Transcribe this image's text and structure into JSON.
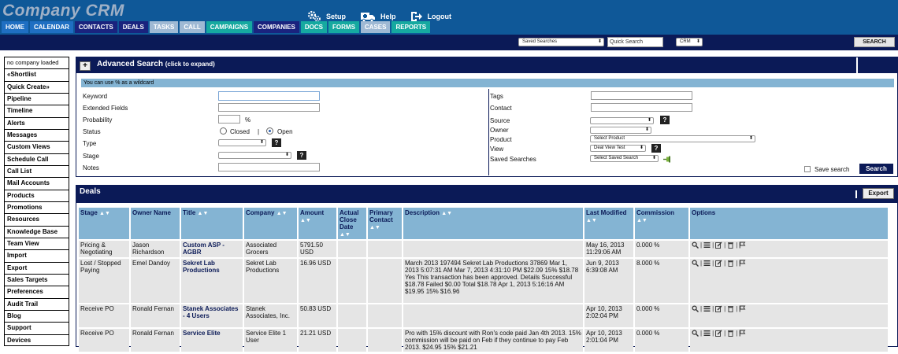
{
  "app": {
    "logo": "Company CRM",
    "top_links": [
      {
        "icon": "gears-icon",
        "label": "Setup"
      },
      {
        "icon": "ambulance-icon",
        "label": "Help"
      },
      {
        "icon": "logout-icon",
        "label": "Logout"
      }
    ],
    "nav_tabs": [
      {
        "label": "HOME",
        "style": "blue"
      },
      {
        "label": "CALENDAR",
        "style": "blue"
      },
      {
        "label": "CONTACTS",
        "style": "dark"
      },
      {
        "label": "DEALS",
        "style": "dark"
      },
      {
        "label": "TASKS",
        "style": "light"
      },
      {
        "label": "CALL",
        "style": "light"
      },
      {
        "label": "CAMPAIGNS",
        "style": "teal"
      },
      {
        "label": "COMPANIES",
        "style": "dark"
      },
      {
        "label": "DOCS",
        "style": "teal"
      },
      {
        "label": "FORMS",
        "style": "teal"
      },
      {
        "label": "CASES",
        "style": "light"
      },
      {
        "label": "REPORTS",
        "style": "teal"
      }
    ]
  },
  "search_bar": {
    "saved_searches": "Saved Searches",
    "quick_search": "Quick Search",
    "scope": "CRM",
    "search_button": "SEARCH"
  },
  "sidebar": {
    "items": [
      "no company loaded",
      "«Shortlist",
      "Quick Create»",
      "Pipeline",
      "Timeline",
      "Alerts",
      "Messages",
      "Custom Views",
      "Schedule Call",
      "Call List",
      "Mail Accounts",
      "Products",
      "Promotions",
      "Resources",
      "Knowledge Base",
      "Team View",
      "Import",
      "Export",
      "Sales Targets",
      "Preferences",
      "Audit Trail",
      "Blog",
      "Support",
      "Devices"
    ]
  },
  "advanced_search": {
    "plus": "+",
    "title": "Advanced Search",
    "subtitle": "(click to expand)",
    "wildcard_note": "You can use % as a wildcard",
    "left_fields": {
      "keyword": "Keyword",
      "extended": "Extended Fields",
      "probability": "Probability",
      "percent": "%",
      "status": "Status",
      "closed": "Closed",
      "divider": "|",
      "open": "Open",
      "type": "Type",
      "stage": "Stage",
      "notes": "Notes"
    },
    "right_fields": {
      "tags": "Tags",
      "contact": "Contact",
      "source": "Source",
      "owner": "Owner",
      "product": "Product",
      "product_value": "Select Product",
      "view": "View",
      "view_value": "Deal View Test",
      "saved_searches": "Saved Searches",
      "saved_value": "Select Saved Search"
    },
    "question": "?",
    "save_search": "Save search",
    "search_button": "Search"
  },
  "deals": {
    "title": "Deals",
    "export": "Export",
    "columns": [
      "Stage",
      "Owner Name",
      "Title",
      "Company",
      "Amount",
      "Actual Close Date",
      "Primary Contact",
      "Description",
      "Last Modified",
      "Commission",
      "Options"
    ],
    "sort_arrows": "▲▼",
    "rows": [
      {
        "stage": "Pricing & Negotiating",
        "owner": "Jason Richardson",
        "title": "Custom ASP - AGBR",
        "company": "Associated Grocers",
        "amount": "5791.50 USD",
        "close_date": "",
        "contact": "",
        "description": "",
        "modified": "May 16, 2013 11:29:06 AM",
        "commission": "0.000 %"
      },
      {
        "stage": "Lost / Stopped Paying",
        "owner": "Emel Dandoy",
        "title": "Sekret Lab Productions",
        "company": "Sekret Lab Productions",
        "amount": "16.96 USD",
        "close_date": "",
        "contact": "",
        "description": "March 2013 197494 Sekret Lab Productions 37869 Mar 1, 2013 5:07:31 AM Mar 7, 2013 4:31:10 PM $22.09 15% $18.78 Yes This transaction has been approved. Details Successful $18.78 Failed $0.00 Total $18.78 Apr 1, 2013 5:16:16 AM $19.95 15% $16.96",
        "modified": "Jun 9, 2013 6:39:08 AM",
        "commission": "8.000 %"
      },
      {
        "stage": "Receive PO",
        "owner": "Ronald Fernan",
        "title": "Stanek Associates - 4 Users",
        "company": "Stanek Associates, Inc.",
        "amount": "50.83 USD",
        "close_date": "",
        "contact": "",
        "description": "",
        "modified": "Apr 10, 2013 2:02:04 PM",
        "commission": "0.000 %"
      },
      {
        "stage": "Receive PO",
        "owner": "Ronald Fernan",
        "title": "Service Elite",
        "company": "Service Elite 1 User",
        "amount": "21.21 USD",
        "close_date": "",
        "contact": "",
        "description": "Pro with 15% discount with Ron's code paid Jan 4th 2013. 15% commission will be paid on Feb if they continue to pay Feb 2013. $24.95 15% $21.21",
        "modified": "Apr 10, 2013 2:01:04 PM",
        "commission": "0.000 %"
      }
    ],
    "option_icons": [
      "search-icon",
      "list-icon",
      "edit-icon",
      "trash-icon",
      "flag-icon"
    ],
    "option_sep": "|"
  }
}
